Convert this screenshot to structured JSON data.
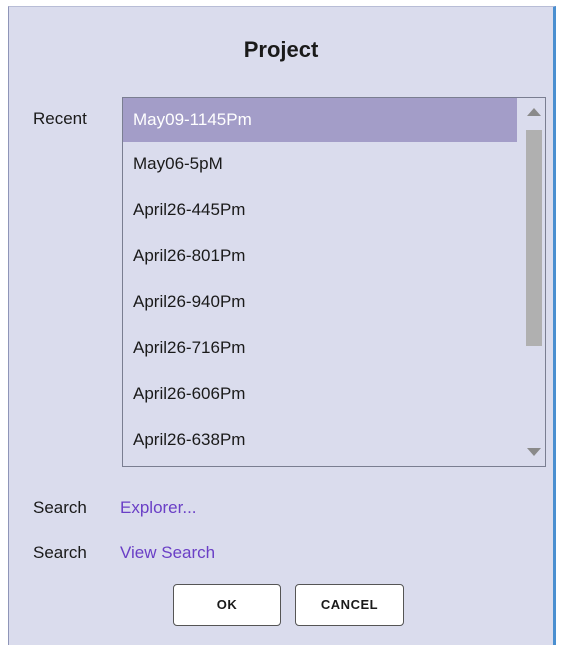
{
  "dialog": {
    "title": "Project"
  },
  "recent": {
    "label": "Recent",
    "selected_index": 0,
    "items": [
      "May09-1145Pm",
      "May06-5pM",
      "April26-445Pm",
      "April26-801Pm",
      "April26-940Pm",
      "April26-716Pm",
      "April26-606Pm",
      "April26-638Pm"
    ]
  },
  "search": [
    {
      "label": "Search",
      "link": "Explorer..."
    },
    {
      "label": "Search",
      "link": "View Search"
    }
  ],
  "buttons": {
    "ok": "OK",
    "cancel": "CANCEL"
  },
  "colors": {
    "dialog_bg": "#dadced",
    "selection": "#a39dc8",
    "link": "#6a3fc6"
  }
}
